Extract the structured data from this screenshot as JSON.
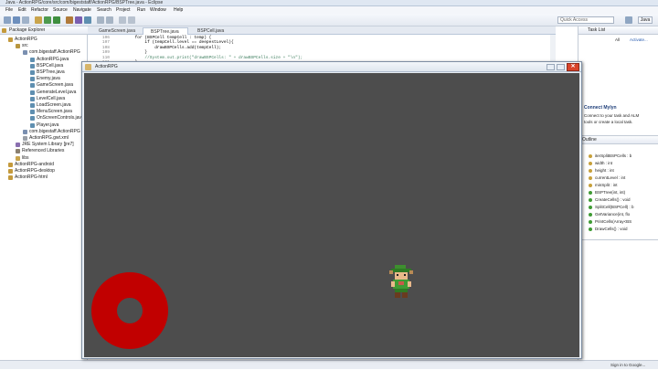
{
  "window_title": "Java - ActionRPG/core/src/com/bigeststaff/ActionRPG/BSPTree.java - Eclipse",
  "menu": [
    "File",
    "Edit",
    "Refactor",
    "Source",
    "Navigate",
    "Search",
    "Project",
    "Run",
    "Window",
    "Help"
  ],
  "quick_access": "Quick Access",
  "perspective": "Java",
  "package_explorer": {
    "title": "Package Explorer",
    "items": [
      {
        "label": "ActionRPG",
        "depth": 0
      },
      {
        "label": "src",
        "depth": 1
      },
      {
        "label": "com.bigestaff.ActionRPG",
        "depth": 2
      },
      {
        "label": "ActionRPG.java",
        "depth": 3
      },
      {
        "label": "BSPCell.java",
        "depth": 3
      },
      {
        "label": "BSPTree.java",
        "depth": 3
      },
      {
        "label": "Enemy.java",
        "depth": 3
      },
      {
        "label": "GameScreen.java",
        "depth": 3
      },
      {
        "label": "GenerateLevel.java",
        "depth": 3
      },
      {
        "label": "LevelCell.java",
        "depth": 3
      },
      {
        "label": "LoadScreen.java",
        "depth": 3
      },
      {
        "label": "MenuScreen.java",
        "depth": 3
      },
      {
        "label": "OnScreenControls.java",
        "depth": 3
      },
      {
        "label": "Player.java",
        "depth": 3
      },
      {
        "label": "com.bigestaff.ActionRPG",
        "depth": 2
      },
      {
        "label": "ActionRPG.gwt.xml",
        "depth": 2
      },
      {
        "label": "JRE System Library [jre7]",
        "depth": 1
      },
      {
        "label": "Referenced Libraries",
        "depth": 1
      },
      {
        "label": "libs",
        "depth": 1
      },
      {
        "label": "ActionRPG-android",
        "depth": 0
      },
      {
        "label": "ActionRPG-desktop",
        "depth": 0
      },
      {
        "label": "ActionRPG-html",
        "depth": 0
      }
    ]
  },
  "editor": {
    "tabs": [
      "GameScreen.java",
      "BSPTree.java",
      "BSPCell.java"
    ],
    "active_tab": 1,
    "lines": [
      {
        "num": "106",
        "text": "        for (BSPCell tempCell : temp) {"
      },
      {
        "num": "107",
        "text": "            if (tempCell.level == deepestLevel){"
      },
      {
        "num": "108",
        "text": "                drawBSPCells.add(tempCell);"
      },
      {
        "num": "109",
        "text": "            }"
      },
      {
        "num": "110",
        "text": "            //System.out.print(\"drawBSPCells: \" + drawBSPCells.size + \"\\n\");"
      },
      {
        "num": "111",
        "text": "        }"
      }
    ]
  },
  "task_list": {
    "title": "Task List",
    "filter_all": "All",
    "activate": "Activate..."
  },
  "mylyn": {
    "title": "Connect Mylyn",
    "line1": "Connect to your task and ALM",
    "line2": "tools or create a local task."
  },
  "outline": {
    "title": "Outline",
    "items": [
      "iterSplitBSPCells : b",
      "width : int",
      "height : int",
      "currentLevel : int",
      "minSplit : int",
      "BSPTree(int, int)",
      "CreateCells() : void",
      "SplitCell(BSPCell) : b",
      "GetVariance(int, flo",
      "PrintCells(Array<BS",
      "DrawCells() : void"
    ]
  },
  "status": "Sign in to Google...",
  "game_window": {
    "title": "ActionRPG",
    "close_glyph": "✕"
  },
  "colors": {
    "game_background": "#4d4d4d",
    "joystick_ring": "#c10000",
    "close_button": "#d9442b"
  }
}
